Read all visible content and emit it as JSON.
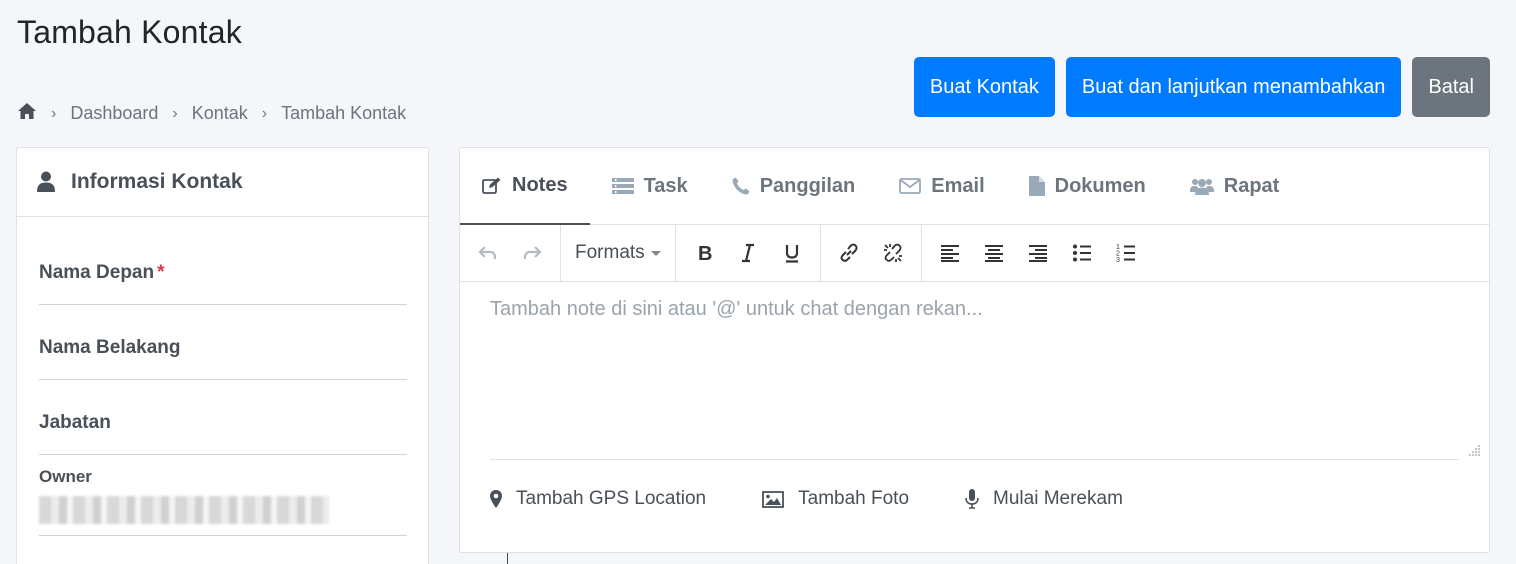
{
  "page": {
    "title": "Tambah Kontak"
  },
  "breadcrumb": {
    "home_icon": "home-icon",
    "items": [
      "Dashboard",
      "Kontak",
      "Tambah Kontak"
    ]
  },
  "actions": {
    "create": "Buat Kontak",
    "create_continue": "Buat dan lanjutkan menambahkan",
    "cancel": "Batal"
  },
  "colors": {
    "primary": "#007bff",
    "secondary": "#6c757d",
    "required": "#dc3545"
  },
  "contact_card": {
    "title": "Informasi Kontak",
    "icon": "user-icon",
    "fields": {
      "first_name": {
        "label": "Nama Depan",
        "required_mark": "*"
      },
      "last_name": {
        "label": "Nama Belakang"
      },
      "position": {
        "label": "Jabatan"
      },
      "owner": {
        "label": "Owner"
      }
    }
  },
  "tabs": [
    {
      "label": "Notes",
      "icon": "edit-icon",
      "active": true
    },
    {
      "label": "Task",
      "icon": "list-icon"
    },
    {
      "label": "Panggilan",
      "icon": "phone-icon"
    },
    {
      "label": "Email",
      "icon": "envelope-icon"
    },
    {
      "label": "Dokumen",
      "icon": "file-icon"
    },
    {
      "label": "Rapat",
      "icon": "users-icon"
    }
  ],
  "editor": {
    "formats_label": "Formats",
    "placeholder": "Tambah note di sini atau '@' untuk chat dengan rekan..."
  },
  "extras": {
    "gps": "Tambah GPS Location",
    "photo": "Tambah Foto",
    "record": "Mulai Merekam"
  }
}
